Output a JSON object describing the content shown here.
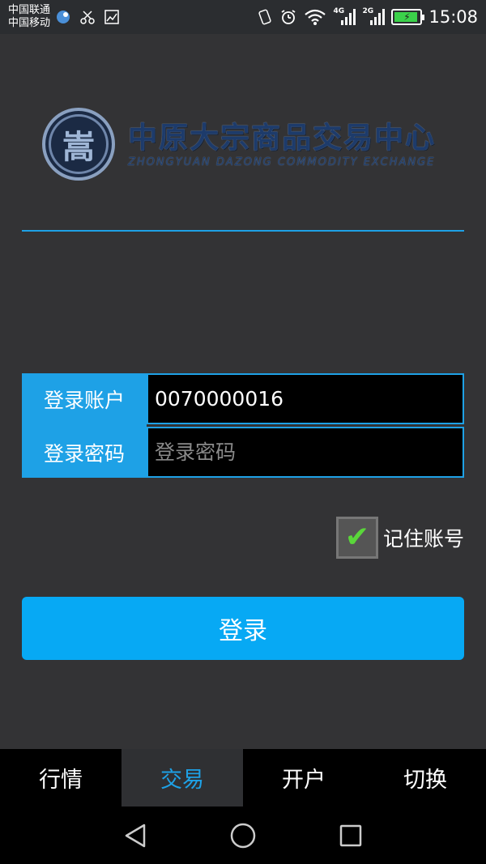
{
  "status_bar": {
    "carrier_1": "中国联通",
    "carrier_2": "中国移动",
    "net_1": "4G",
    "net_2": "2G",
    "time": "15:08"
  },
  "logo": {
    "emblem_char": "嵩",
    "name_cn": "中原大宗商品交易中心",
    "name_en": "ZHONGYUAN DAZONG COMMODITY EXCHANGE"
  },
  "login": {
    "account_label": "登录账户",
    "account_value": "0070000016",
    "password_label": "登录密码",
    "password_placeholder": "登录密码",
    "remember_label": "记住账号",
    "remember_checked": true,
    "submit_label": "登录"
  },
  "tabs": [
    {
      "label": "行情"
    },
    {
      "label": "交易",
      "active": true
    },
    {
      "label": "开户"
    },
    {
      "label": "切换"
    }
  ],
  "colors": {
    "accent": "#1ea1e6",
    "button": "#07a9f4",
    "background": "#333335",
    "check": "#5ad63a"
  }
}
